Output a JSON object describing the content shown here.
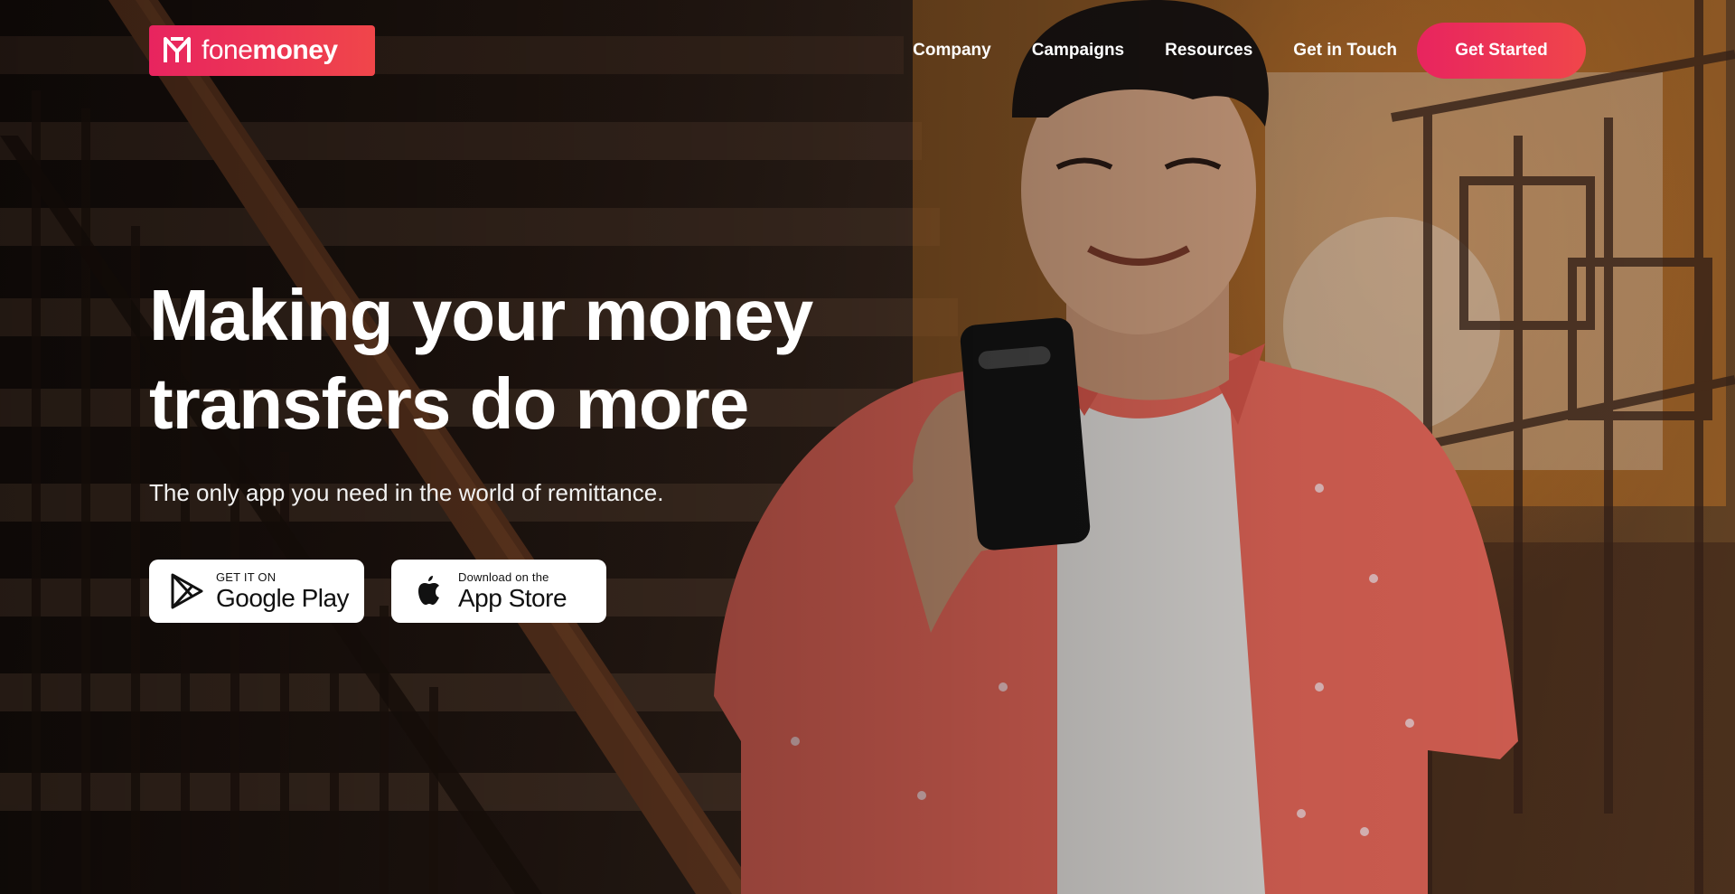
{
  "brand": {
    "name_light": "fone",
    "name_bold": "money",
    "accent_start": "#e8245f",
    "accent_end": "#f0464a"
  },
  "nav": {
    "links": [
      "Company",
      "Campaigns",
      "Resources",
      "Get in Touch"
    ],
    "cta_label": "Get Started"
  },
  "hero": {
    "headline_line1": "Making your money",
    "headline_line2": "transfers do more",
    "subtext": "The only app you need in the world of remittance."
  },
  "stores": {
    "google": {
      "small": "GET IT ON",
      "big": "Google Play",
      "icon": "google-play-icon"
    },
    "apple": {
      "small": "Download on the",
      "big": "App Store",
      "icon": "apple-icon"
    }
  }
}
